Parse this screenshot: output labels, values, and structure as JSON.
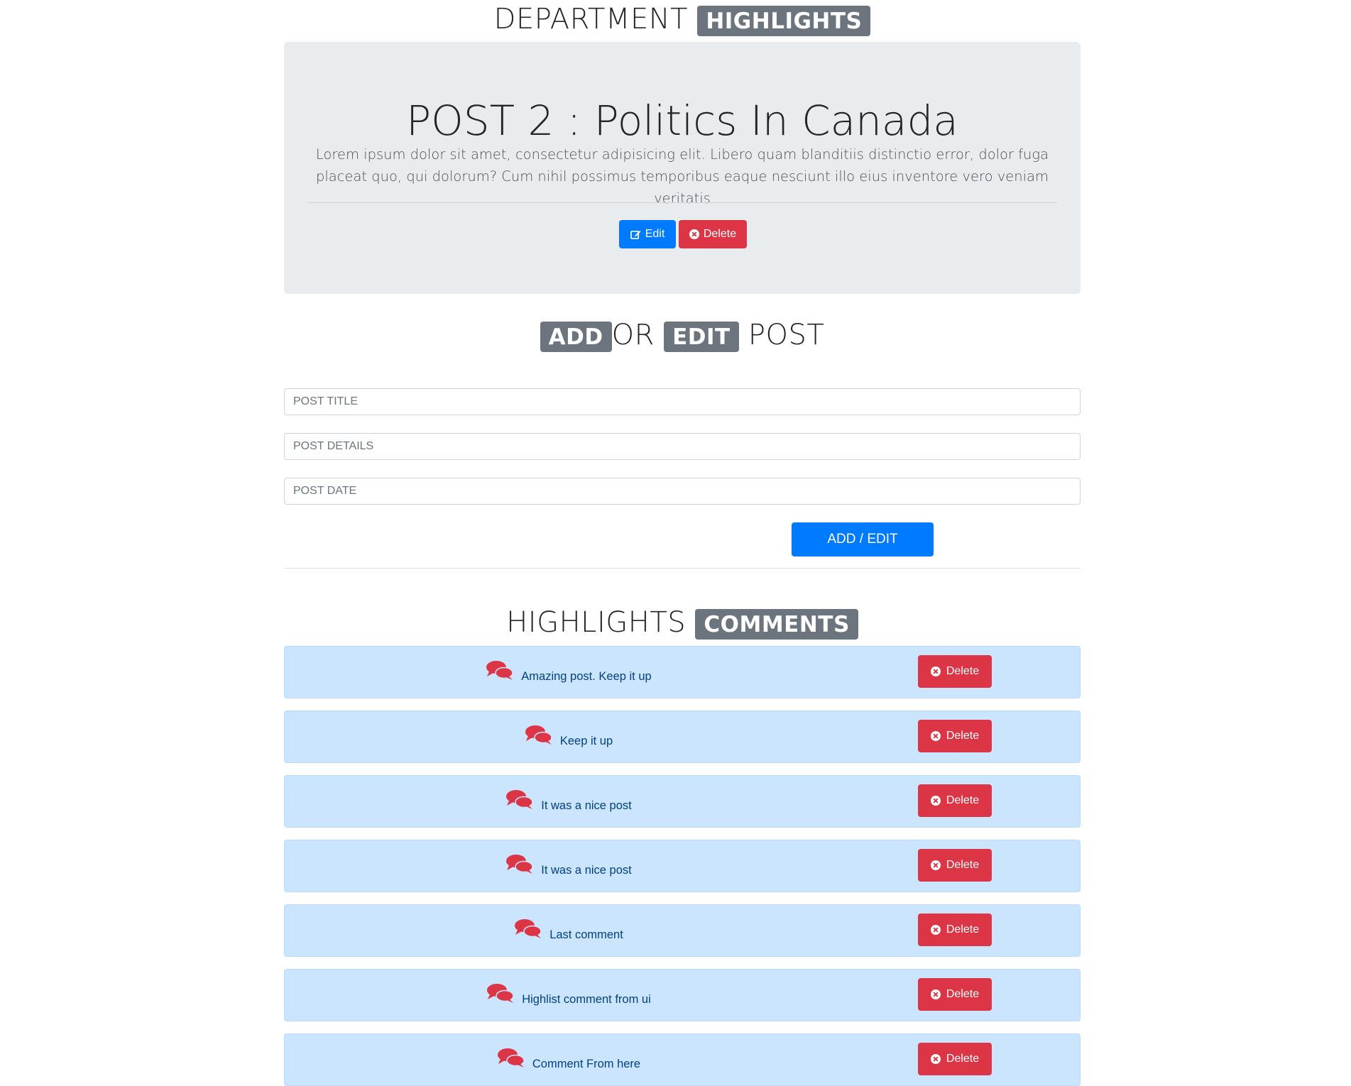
{
  "header": {
    "title_plain": "DEPARTMENT",
    "title_badge": "HIGHLIGHTS"
  },
  "post": {
    "title": "POST 2 : Politics In Canada",
    "details": "Lorem ipsum dolor sit amet, consectetur adipisicing elit. Libero quam blanditiis distinctio error, dolor fuga placeat quo, qui dolorum? Cum nihil possimus temporibus eaque nesciunt illo eius inventore vero veniam veritatis",
    "edit_label": "Edit",
    "delete_label": "Delete"
  },
  "form": {
    "title_badge_add": "ADD",
    "title_or": "OR",
    "title_badge_edit": "EDIT",
    "title_post": "POST",
    "title_placeholder": "POST TITLE",
    "details_placeholder": "POST DETAILS",
    "date_placeholder": "POST DATE",
    "submit_label": "ADD / EDIT"
  },
  "comments_section": {
    "title_plain": "HIGHLIGHTS",
    "title_badge": "COMMENTS",
    "delete_label": "Delete",
    "icon": "comments-icon",
    "items": [
      {
        "text": "Amazing post. Keep it up"
      },
      {
        "text": "Keep it up"
      },
      {
        "text": "It was a nice post"
      },
      {
        "text": "It was a nice post"
      },
      {
        "text": "Last comment"
      },
      {
        "text": "Highlist comment from ui"
      },
      {
        "text": "Comment From here"
      }
    ]
  },
  "colors": {
    "primary": "#007bff",
    "danger": "#dc3545",
    "badge": "#6c757d",
    "comment_bg": "#cce5ff",
    "comment_text": "#004085",
    "jumbotron_bg": "#e9ecef"
  }
}
